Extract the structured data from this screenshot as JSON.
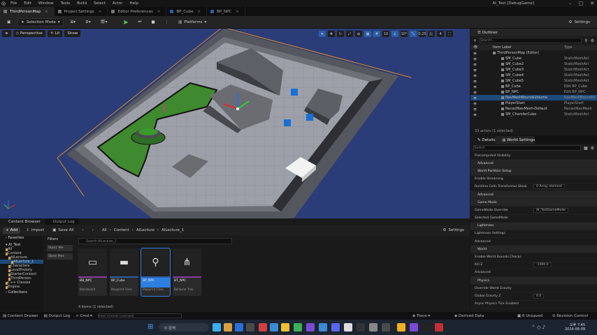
{
  "menu": [
    "File",
    "Edit",
    "Window",
    "Tools",
    "Build",
    "Select",
    "Actor",
    "Help"
  ],
  "project_name": "AI_Test [DebugGame]",
  "tabs": [
    {
      "label": "ThirdPersonMap",
      "active": true
    },
    {
      "label": "Project Settings",
      "active": false
    },
    {
      "label": "Editor Preferences",
      "active": false
    },
    {
      "label": "BP_Cube",
      "active": false
    },
    {
      "label": "BP_NPC",
      "active": false
    }
  ],
  "toolbar": {
    "mode": "Selection Mode",
    "platforms": "Platforms",
    "settings": "Settings"
  },
  "viewport": {
    "perspective": "Perspective",
    "lit": "Lit",
    "show": "Show",
    "snap_value": "10",
    "rot_value": "10°",
    "scale_value": "0.25",
    "cam_speed": "4"
  },
  "outliner": {
    "tab": "Outliner",
    "search_placeholder": "Search...",
    "col_label": "Item Label",
    "col_type": "Type",
    "rows": [
      {
        "label": "ThirdPersonMap (Editor)",
        "type": "",
        "sel": false
      },
      {
        "label": "SM_Cube",
        "type": "StaticMeshAct",
        "sel": false
      },
      {
        "label": "SM_Cube2",
        "type": "StaticMeshAct",
        "sel": false
      },
      {
        "label": "SM_Cube3",
        "type": "StaticMeshAct",
        "sel": false
      },
      {
        "label": "SM_Cube4",
        "type": "StaticMeshAct",
        "sel": false
      },
      {
        "label": "SM_Cube5",
        "type": "StaticMeshAct",
        "sel": false
      },
      {
        "label": "BP_Cube",
        "type": "Edit BP_Cube",
        "sel": false
      },
      {
        "label": "BP_NPC",
        "type": "Edit BP_NPC",
        "sel": false
      },
      {
        "label": "NavMeshBoundsVolume",
        "type": "NavMeshBoundsV",
        "sel": true
      },
      {
        "label": "PlayerStart",
        "type": "PlayerStart",
        "sel": false
      },
      {
        "label": "RecastNavMesh-Default",
        "type": "RecastNavMesh",
        "sel": false
      },
      {
        "label": "SM_ChamferCube",
        "type": "StaticMeshAct",
        "sel": false
      }
    ],
    "footer": "33 actors (1 selected)"
  },
  "details": {
    "tabs": [
      "Details",
      "World Settings"
    ],
    "search_placeholder": "Search",
    "rows": [
      {
        "k": "Precomputed Visibility",
        "v": "",
        "hdr": false
      },
      {
        "k": "Advanced",
        "v": "",
        "hdr": true
      },
      {
        "k": "World Partition Setup",
        "v": "",
        "hdr": true
      },
      {
        "k": "Enable Streaming",
        "v": "",
        "hdr": false
      },
      {
        "k": "Runtime Cells Transformer Stack",
        "v": "0 Array element",
        "hdr": false
      },
      {
        "k": "Advanced",
        "v": "",
        "hdr": true
      },
      {
        "k": "Game Mode",
        "v": "",
        "hdr": true
      },
      {
        "k": "GameMode Override",
        "v": "AI_TestGameMode",
        "hdr": false
      },
      {
        "k": "Selected GameMode",
        "v": "",
        "hdr": false
      },
      {
        "k": "Lightmass",
        "v": "",
        "hdr": true
      },
      {
        "k": "Lightmass Settings",
        "v": "",
        "hdr": false
      },
      {
        "k": "Advanced",
        "v": "",
        "hdr": false
      },
      {
        "k": "World",
        "v": "",
        "hdr": true
      },
      {
        "k": "Enable World Bounds Checks",
        "v": "",
        "hdr": false
      },
      {
        "k": "Kill Z",
        "v": "-1000.0",
        "hdr": false
      },
      {
        "k": "Advanced",
        "v": "",
        "hdr": false
      },
      {
        "k": "Physics",
        "v": "",
        "hdr": true
      },
      {
        "k": "Override World Gravity",
        "v": "",
        "hdr": false
      },
      {
        "k": "Global Gravity Z",
        "v": "0.0",
        "hdr": false
      },
      {
        "k": "Async Physics Tick Enabled",
        "v": "",
        "hdr": false
      }
    ]
  },
  "content_browser": {
    "tab": "Content Browser",
    "tab2": "Output Log",
    "add": "Add",
    "import": "Import",
    "save_all": "Save All",
    "breadcrumb": [
      "All",
      "Content",
      "AILecture",
      "AILecture_1"
    ],
    "settings": "Settings",
    "search_placeholder": "Search AILecture_1",
    "favorites": "Favorites",
    "project": "AI_Test",
    "tree": [
      "All",
      "Content",
      "AILecture",
      "AILecture_1",
      "Characters",
      "LevelPrototy",
      "StarterContent",
      "ThirdPerson",
      "C++ Classes",
      "Engine"
    ],
    "collections": "Collections",
    "filters": "Filters",
    "filter_btns": [
      "Static Me",
      "Skele Mes"
    ],
    "assets": [
      {
        "name": "BB_NPC",
        "type": "Blackboard",
        "color": "#8a3aa0"
      },
      {
        "name": "BP_Cube",
        "type": "Blueprint Class",
        "color": "#2c5fa8"
      },
      {
        "name": "BP_NPC",
        "type": "Blueprint Class",
        "color": "#2c5fa8"
      },
      {
        "name": "BT_NPC",
        "type": "Behavior Tree",
        "color": "#8a3aa0"
      }
    ],
    "count": "4 items (1 selected)"
  },
  "statusbar": {
    "drawer": "Content Drawer",
    "output": "Output Log",
    "cmd": "Cmd",
    "cmd_placeholder": "Enter Console Command",
    "trace": "Trace",
    "derived": "Derived Data",
    "unsaved": "6 Unsaved",
    "revision": "Revision Control"
  },
  "taskbar": {
    "search": "검색",
    "time": "오후 7:45",
    "date": "2024-06-09"
  }
}
